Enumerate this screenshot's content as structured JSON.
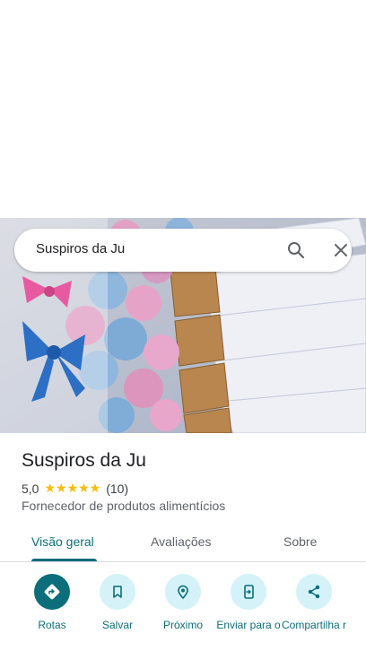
{
  "search": {
    "query": "Suspiros da Ju"
  },
  "place": {
    "title": "Suspiros da Ju",
    "rating": "5,0",
    "stars": "★★★★★",
    "review_count": "(10)",
    "category": "Fornecedor de produtos alimentícios"
  },
  "tabs": [
    {
      "label": "Visão geral",
      "active": true
    },
    {
      "label": "Avaliações",
      "active": false
    },
    {
      "label": "Sobre",
      "active": false
    }
  ],
  "actions": [
    {
      "label": "Rotas",
      "icon": "directions-icon"
    },
    {
      "label": "Salvar",
      "icon": "bookmark-icon"
    },
    {
      "label": "Próximo",
      "icon": "nearby-icon"
    },
    {
      "label": "Enviar para o",
      "icon": "send-to-phone-icon"
    },
    {
      "label": "Compartilha r",
      "icon": "share-icon"
    }
  ],
  "colors": {
    "accent": "#0b6e7a",
    "action_bg": "#d4f2f8",
    "star": "#fbbc04"
  }
}
